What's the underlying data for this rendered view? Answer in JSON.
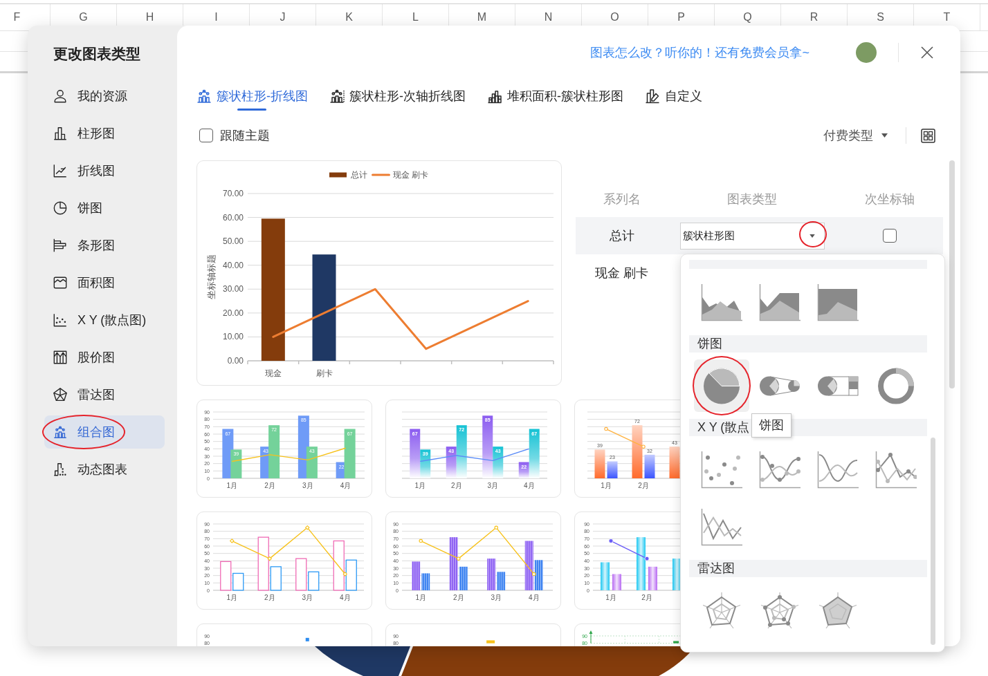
{
  "sheet": {
    "columns": [
      "F",
      "G",
      "H",
      "I",
      "J",
      "K",
      "L",
      "M",
      "N",
      "O",
      "P",
      "Q",
      "R",
      "S",
      "T"
    ]
  },
  "sidebar": {
    "title": "更改图表类型",
    "items": [
      {
        "label": "我的资源",
        "kind": "user",
        "selected": false,
        "circled": false
      },
      {
        "label": "柱形图",
        "kind": "column",
        "selected": false,
        "circled": false
      },
      {
        "label": "折线图",
        "kind": "line",
        "selected": false,
        "circled": false
      },
      {
        "label": "饼图",
        "kind": "pie",
        "selected": false,
        "circled": false
      },
      {
        "label": "条形图",
        "kind": "bar",
        "selected": false,
        "circled": false
      },
      {
        "label": "面积图",
        "kind": "area",
        "selected": false,
        "circled": false
      },
      {
        "label": "X Y (散点图)",
        "kind": "scatter",
        "selected": false,
        "circled": false
      },
      {
        "label": "股价图",
        "kind": "stock",
        "selected": false,
        "circled": false
      },
      {
        "label": "雷达图",
        "kind": "radar",
        "selected": false,
        "circled": false
      },
      {
        "label": "组合图",
        "kind": "combo",
        "selected": true,
        "circled": true
      },
      {
        "label": "动态图表",
        "kind": "dynamic",
        "selected": false,
        "circled": false
      }
    ]
  },
  "header": {
    "link": "图表怎么改？听你的！还有免费会员拿~"
  },
  "tabs": [
    {
      "label": "簇状柱形-折线图",
      "kind": "combo",
      "selected": true
    },
    {
      "label": "簇状柱形-次轴折线图",
      "kind": "combo-secondary",
      "selected": false
    },
    {
      "label": "堆积面积-簇状柱形图",
      "kind": "stacked",
      "selected": false
    },
    {
      "label": "自定义",
      "kind": "custom",
      "selected": false
    }
  ],
  "toolbar": {
    "follow_theme": {
      "label": "跟随主题",
      "checked": false
    },
    "filter": {
      "label": "付费类型"
    }
  },
  "preview": {
    "chart_data": {
      "type": "bar",
      "ylabel": "坐标轴标题",
      "categories": [
        "现金",
        "刷卡",
        null,
        null,
        null,
        null
      ],
      "ylim": [
        0,
        70
      ],
      "yticks": [
        {
          "value": 0,
          "label": "0.00"
        },
        {
          "value": 10,
          "label": "10.00"
        },
        {
          "value": 20,
          "label": "20.00"
        },
        {
          "value": 30,
          "label": "30.00"
        },
        {
          "value": 40,
          "label": "40.00"
        },
        {
          "value": 50,
          "label": "50.00"
        },
        {
          "value": 60,
          "label": "60.00"
        },
        {
          "value": 70,
          "label": "70.00"
        }
      ],
      "grid": true,
      "legend": "top",
      "series": [
        {
          "name": "总计",
          "color": "#843c0c",
          "values": [
            59.5,
            null,
            null,
            null,
            null,
            null
          ]
        },
        {
          "color": "#1f3864",
          "values": [
            null,
            44.5,
            null,
            null,
            null,
            null
          ]
        },
        {
          "name": "现金 刷卡",
          "type": "line",
          "color": "#ed7d31",
          "values": [
            10,
            20,
            30,
            5,
            15,
            25
          ]
        }
      ]
    }
  },
  "series_table": {
    "columns": [
      "系列名",
      "图表类型",
      "次坐标轴"
    ],
    "rows": [
      {
        "name": "总计",
        "chart_type": {
          "value": "簇状柱形图",
          "circled": true
        },
        "secondary_axis": false,
        "selected": true
      },
      {
        "name": "现金 刷卡",
        "selected": false
      }
    ]
  },
  "thumbnails": [
    {
      "kind": "flat",
      "chart_data": {
        "type": "bar",
        "categories": [
          "1月",
          "2月",
          "3月",
          "4月"
        ],
        "ylim": [
          0,
          90
        ],
        "yticks": [
          0,
          10,
          20,
          30,
          40,
          50,
          60,
          70,
          80,
          90
        ],
        "grid": true,
        "series": [
          {
            "color": "#6f9bf7",
            "values": [
              67,
              43,
              85,
              22
            ],
            "value_labels": [
              "67",
              "43",
              "85",
              "22"
            ]
          },
          {
            "color": "#74d29a",
            "values": [
              39,
              72,
              43,
              67
            ],
            "value_labels": [
              "39",
              "72",
              "43",
              "67"
            ]
          },
          {
            "type": "line",
            "color": "#f7c21c",
            "values": [
              23,
              32,
              25,
              41
            ]
          }
        ]
      }
    },
    {
      "kind": "gradient",
      "chart_data": {
        "type": "bar",
        "categories": [
          "1月",
          "2月",
          "3月",
          "4月"
        ],
        "ylim": [
          0,
          90
        ],
        "grid": true,
        "series": [
          {
            "color": "#8b5cf0",
            "values": [
              67,
              43,
              85,
              22
            ],
            "value_labels": [
              "67",
              "43",
              "85",
              "22"
            ]
          },
          {
            "color": "#16c2d4",
            "values": [
              39,
              72,
              43,
              67
            ],
            "value_labels": [
              "39",
              "72",
              "43",
              "67"
            ]
          },
          {
            "type": "line",
            "color": "#5b8cf7",
            "values": [
              23,
              31,
              24,
              40
            ]
          }
        ]
      }
    },
    {
      "kind": "warm-gradient",
      "chart_data": {
        "type": "bar",
        "categories": [
          "1月",
          "2月",
          null,
          null
        ],
        "ylim": [
          0,
          90
        ],
        "grid": true,
        "series": [
          {
            "color": "#ff6b2c",
            "values": [
              39,
              72,
              43,
              null
            ],
            "value_labels": [
              "39",
              "72",
              "43",
              null
            ]
          },
          {
            "color": "#3b55ff",
            "values": [
              23,
              32,
              null,
              null
            ],
            "value_labels": [
              "23",
              "32",
              null,
              null
            ]
          },
          {
            "type": "line",
            "color": "#ffb23f",
            "marker": "circle",
            "values": [
              67,
              43,
              null,
              null
            ]
          }
        ]
      }
    },
    {
      "kind": "outline",
      "chart_data": {
        "type": "bar",
        "categories": [
          "1月",
          "2月",
          "3月",
          "4月"
        ],
        "ylim": [
          0,
          90
        ],
        "yticks": [
          0,
          10,
          20,
          30,
          40,
          50,
          60,
          70,
          80,
          90
        ],
        "grid": true,
        "series": [
          {
            "color": "#f06bb5",
            "values": [
              39,
              72,
              43,
              67
            ]
          },
          {
            "color": "#2c9af5",
            "values": [
              23,
              32,
              25,
              41
            ]
          },
          {
            "type": "line",
            "color": "#f7c21c",
            "marker": "diamond",
            "values": [
              67,
              43,
              85,
              22
            ]
          }
        ]
      }
    },
    {
      "kind": "striped",
      "chart_data": {
        "type": "bar",
        "categories": [
          "1月",
          "2月",
          "3月",
          "4月"
        ],
        "ylim": [
          0,
          90
        ],
        "yticks": [
          0,
          10,
          20,
          30,
          40,
          50,
          60,
          70,
          80,
          90
        ],
        "grid": true,
        "series": [
          {
            "color": "#8656f2",
            "values": [
              39,
              72,
              43,
              67
            ]
          },
          {
            "color": "#2f7af0",
            "values": [
              23,
              32,
              25,
              41
            ]
          },
          {
            "type": "line",
            "color": "#f7c21c",
            "marker": "circle",
            "values": [
              67,
              43,
              85,
              22
            ]
          }
        ]
      }
    },
    {
      "kind": "glass",
      "chart_data": {
        "type": "bar",
        "categories": [
          "1月",
          "2月",
          null,
          null
        ],
        "ylim": [
          0,
          90
        ],
        "yticks": [
          0,
          10,
          20,
          30,
          40,
          50,
          60,
          70,
          80,
          90
        ],
        "grid": true,
        "series": [
          {
            "color": "#1ec8f2",
            "values": [
              38,
              72,
              43,
              null
            ]
          },
          {
            "color": "#b86af2",
            "values": [
              22,
              32,
              null,
              null
            ]
          },
          {
            "type": "line",
            "color": "#6a5cf7",
            "marker": "circle",
            "values": [
              67,
              43,
              null,
              null
            ]
          }
        ]
      }
    },
    {
      "kind": "line-markers",
      "chart_data": {
        "type": "line",
        "ylim": [
          80,
          90
        ],
        "yticks": [
          80,
          90
        ],
        "series": [
          {
            "color": "#2d8cf0",
            "marker": "square",
            "values": [
              null,
              null,
              85,
              null
            ]
          }
        ]
      }
    },
    {
      "kind": "plain",
      "chart_data": {
        "type": "bar",
        "ylim": [
          80,
          90
        ],
        "yticks": [
          80,
          90
        ],
        "series": [
          {
            "color": "#f7c21c",
            "values": [
              null,
              null,
              84,
              null
            ]
          }
        ]
      }
    },
    {
      "kind": "green-grid",
      "chart_data": {
        "type": "bar",
        "ylim": [
          80,
          90
        ],
        "yticks": [
          80,
          90
        ],
        "grid": true,
        "series": [
          {
            "color": "#2ea64a",
            "values": [
              null,
              null,
              83,
              null
            ]
          }
        ]
      }
    }
  ],
  "dropdown": {
    "sections": [
      {
        "options": [
          {
            "kind": "area",
            "selected": false,
            "circled": false
          },
          {
            "kind": "stacked-area",
            "selected": false,
            "circled": false
          },
          {
            "kind": "percent-area",
            "selected": false,
            "circled": false
          }
        ]
      },
      {
        "title": "饼图",
        "options": [
          {
            "kind": "pie",
            "selected": true,
            "circled": true
          },
          {
            "kind": "pie-of-pie",
            "selected": false,
            "circled": false
          },
          {
            "kind": "bar-of-pie",
            "selected": false,
            "circled": false
          },
          {
            "kind": "doughnut",
            "selected": false,
            "circled": false
          }
        ]
      },
      {
        "title": "X Y (散点",
        "options": [
          {
            "kind": "scatter",
            "selected": false,
            "circled": false
          },
          {
            "kind": "scatter-smooth-markers",
            "selected": false,
            "circled": false
          },
          {
            "kind": "scatter-smooth",
            "selected": false,
            "circled": false
          },
          {
            "kind": "scatter-lines-markers",
            "selected": false,
            "circled": false
          },
          {
            "kind": "scatter-lines",
            "selected": false,
            "circled": false
          }
        ]
      },
      {
        "title": "雷达图",
        "options": [
          {
            "kind": "radar",
            "selected": false,
            "circled": false
          },
          {
            "kind": "radar-markers",
            "selected": false,
            "circled": false
          },
          {
            "kind": "radar-filled",
            "selected": false,
            "circled": false
          }
        ]
      }
    ]
  },
  "tooltip": {
    "text": "饼图"
  }
}
